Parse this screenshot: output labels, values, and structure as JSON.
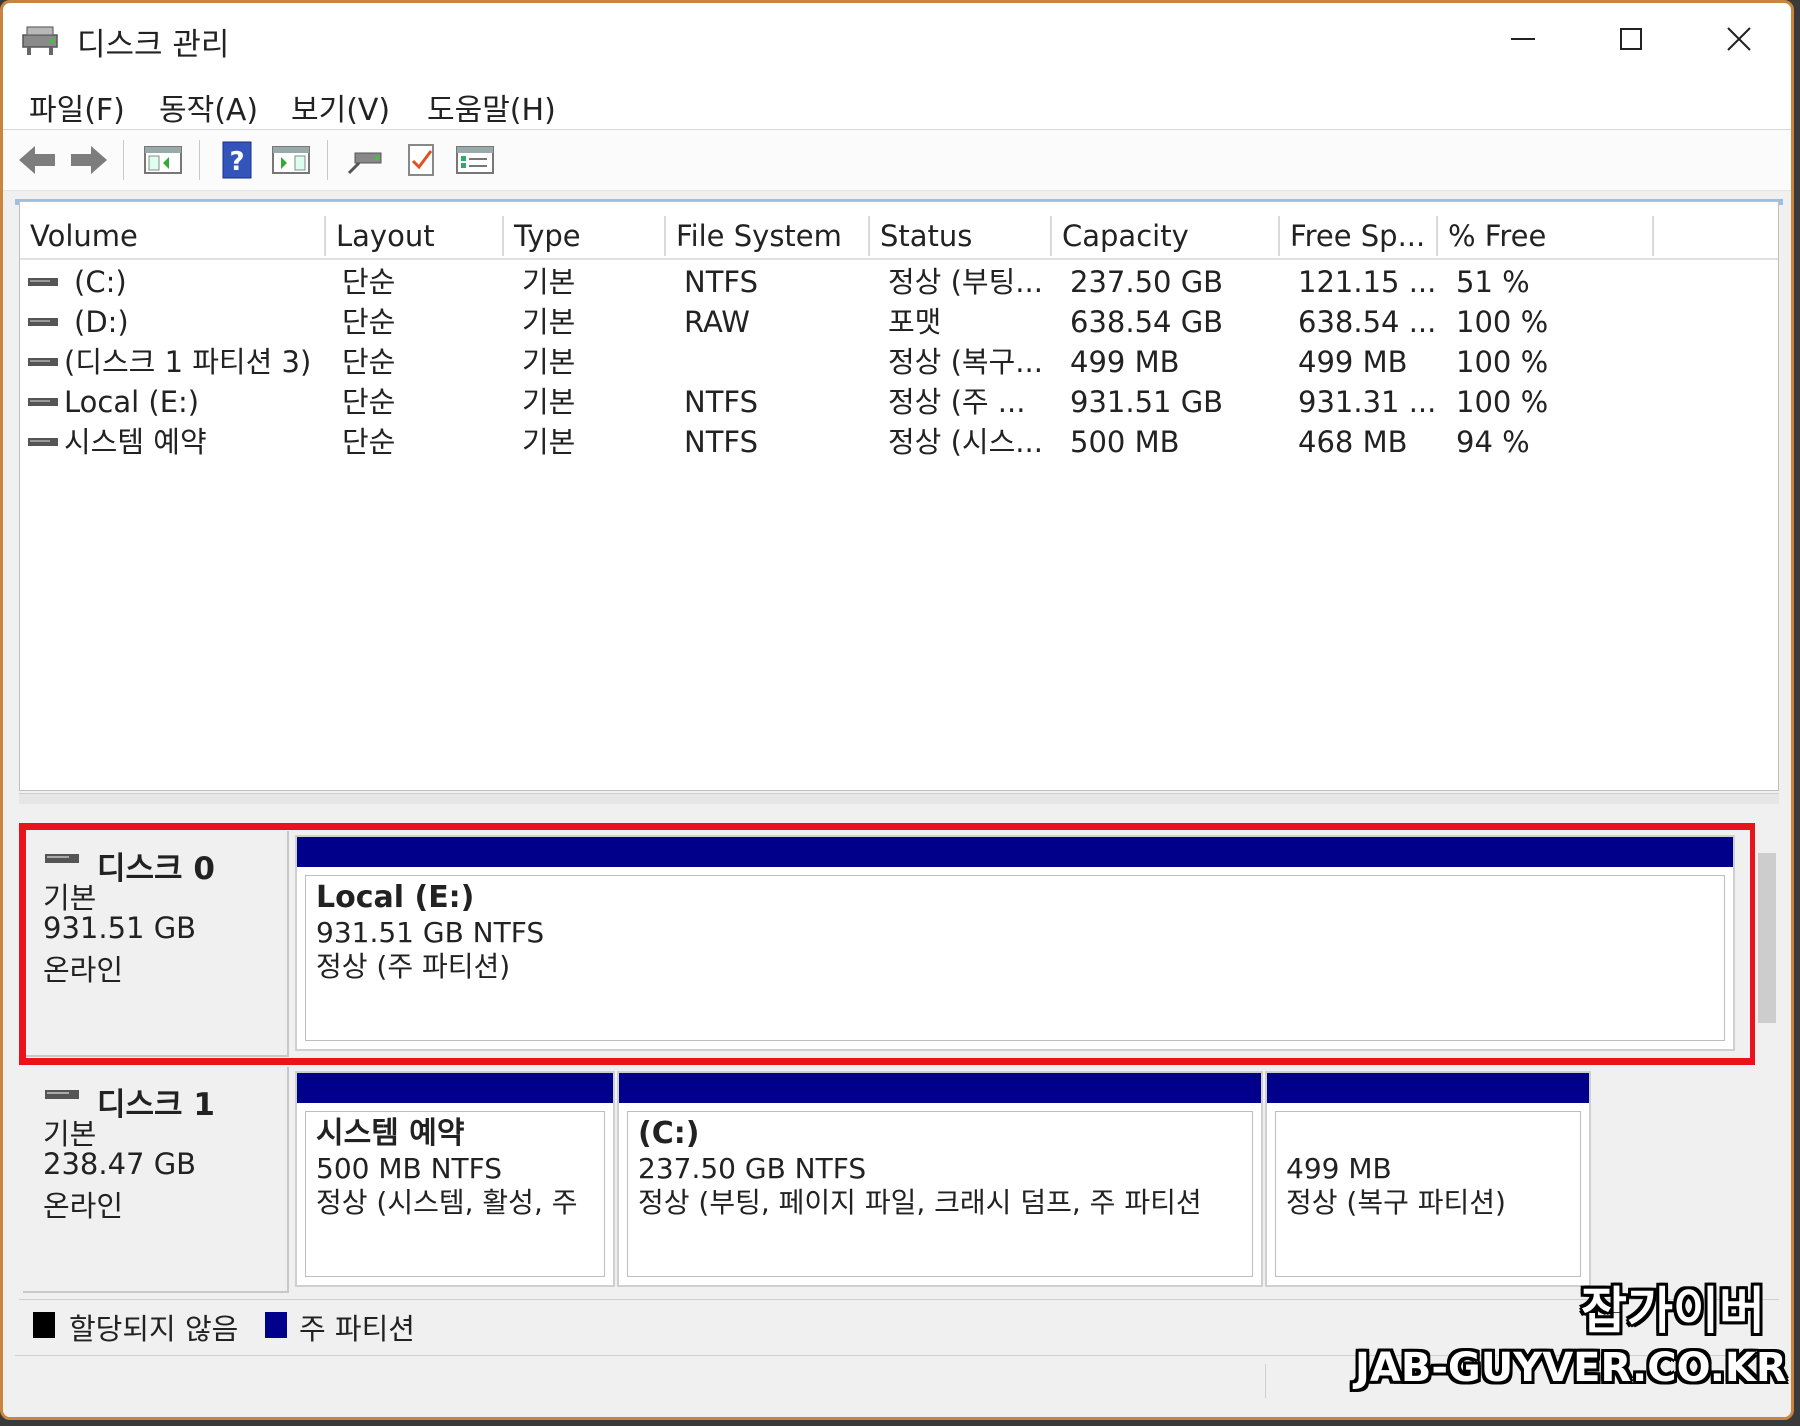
{
  "window": {
    "title": "디스크 관리"
  },
  "menu": {
    "items": [
      "파일(F)",
      "동작(A)",
      "보기(V)",
      "도움말(H)"
    ]
  },
  "toolbar": {
    "buttons": [
      "back-icon",
      "forward-icon",
      "show-hide-console-tree-icon",
      "help-icon",
      "show-hide-action-pane-icon",
      "connect-drive-icon",
      "check-icon",
      "properties-icon"
    ]
  },
  "volume_table": {
    "columns": [
      "Volume",
      "Layout",
      "Type",
      "File System",
      "Status",
      "Capacity",
      "Free Sp...",
      "% Free"
    ],
    "rows": [
      {
        "volume": "(C:)",
        "layout": "단순",
        "type": "기본",
        "fs": "NTFS",
        "status": "정상 (부팅...",
        "capacity": "237.50 GB",
        "free": "121.15 ...",
        "pct": "51 %"
      },
      {
        "volume": "(D:)",
        "layout": "단순",
        "type": "기본",
        "fs": "RAW",
        "status": "포맷",
        "capacity": "638.54 GB",
        "free": "638.54 ...",
        "pct": "100 %"
      },
      {
        "volume": "(디스크 1 파티션 3)",
        "layout": "단순",
        "type": "기본",
        "fs": "",
        "status": "정상 (복구...",
        "capacity": "499 MB",
        "free": "499 MB",
        "pct": "100 %"
      },
      {
        "volume": "Local (E:)",
        "layout": "단순",
        "type": "기본",
        "fs": "NTFS",
        "status": "정상 (주 ...",
        "capacity": "931.51 GB",
        "free": "931.31 ...",
        "pct": "100 %"
      },
      {
        "volume": "시스템 예약",
        "layout": "단순",
        "type": "기본",
        "fs": "NTFS",
        "status": "정상 (시스...",
        "capacity": "500 MB",
        "free": "468 MB",
        "pct": "94 %"
      }
    ]
  },
  "disks": [
    {
      "name": "디스크 0",
      "kind": "기본",
      "size": "931.51 GB",
      "state": "온라인",
      "partitions": [
        {
          "name": "Local  (E:)",
          "size_fs": "931.51 GB NTFS",
          "status": "정상 (주 파티션)"
        }
      ]
    },
    {
      "name": "디스크 1",
      "kind": "기본",
      "size": "238.47 GB",
      "state": "온라인",
      "partitions": [
        {
          "name": "시스템 예약",
          "size_fs": "500 MB NTFS",
          "status": "정상 (시스템, 활성, 주"
        },
        {
          "name": "(C:)",
          "size_fs": "237.50 GB NTFS",
          "status": "정상 (부팅, 페이지 파일, 크래시 덤프, 주 파티션"
        },
        {
          "name": "",
          "size_fs": "499 MB",
          "status": "정상 (복구 파티션)"
        }
      ]
    }
  ],
  "legend": {
    "unallocated": "할당되지 않음",
    "primary": "주 파티션",
    "unallocated_color": "#000000",
    "primary_color": "#00008b"
  },
  "watermark": {
    "korean": "잡가이버",
    "english": "JAB-GUYVER.CO.KR"
  },
  "colors": {
    "highlight": "#e8131b",
    "partition_bar": "#00008b"
  }
}
